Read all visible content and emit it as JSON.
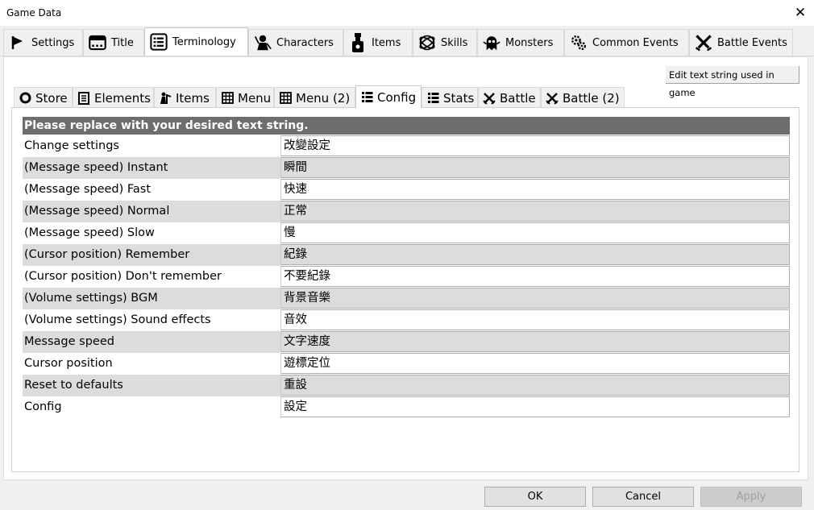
{
  "window": {
    "title": "Game Data",
    "close_glyph": "✕"
  },
  "main_tabs": [
    {
      "label": "Settings",
      "icon": "flag-icon"
    },
    {
      "label": "Title",
      "icon": "window-icon"
    },
    {
      "label": "Terminology",
      "icon": "list-icon",
      "active": true
    },
    {
      "label": "Characters",
      "icon": "character-icon"
    },
    {
      "label": "Items",
      "icon": "potion-icon"
    },
    {
      "label": "Skills",
      "icon": "orbit-icon"
    },
    {
      "label": "Monsters",
      "icon": "ghost-icon"
    },
    {
      "label": "Common Events",
      "icon": "gears-icon"
    },
    {
      "label": "Battle Events",
      "icon": "crossed-swords-icon"
    }
  ],
  "hint": "Edit text string used in game",
  "sub_tabs": [
    {
      "label": "Store",
      "icon": "circle-icon"
    },
    {
      "label": "Elements",
      "icon": "document-icon"
    },
    {
      "label": "Items",
      "icon": "items-icon"
    },
    {
      "label": "Menu",
      "icon": "grid-icon"
    },
    {
      "label": "Menu (2)",
      "icon": "grid-icon"
    },
    {
      "label": "Config",
      "icon": "list-icon",
      "active": true
    },
    {
      "label": "Stats",
      "icon": "list-icon"
    },
    {
      "label": "Battle",
      "icon": "swords-icon"
    },
    {
      "label": "Battle (2)",
      "icon": "swords-icon"
    }
  ],
  "table": {
    "header": "Please replace with your desired text string.",
    "rows": [
      {
        "key": "Change settings",
        "value": "改變設定"
      },
      {
        "key": "(Message speed) Instant",
        "value": "瞬間"
      },
      {
        "key": "(Message speed) Fast",
        "value": "快速"
      },
      {
        "key": "(Message speed) Normal",
        "value": "正常"
      },
      {
        "key": "(Message speed) Slow",
        "value": "慢"
      },
      {
        "key": "(Cursor position) Remember",
        "value": "紀錄"
      },
      {
        "key": "(Cursor position) Don't remember",
        "value": "不要紀錄"
      },
      {
        "key": "(Volume settings) BGM",
        "value": "背景音樂"
      },
      {
        "key": "(Volume settings) Sound effects",
        "value": "音效"
      },
      {
        "key": "Message speed",
        "value": "文字速度"
      },
      {
        "key": "Cursor position",
        "value": "遊標定位"
      },
      {
        "key": "Reset to defaults",
        "value": "重設"
      },
      {
        "key": "Config",
        "value": "設定"
      }
    ]
  },
  "buttons": {
    "ok": "OK",
    "cancel": "Cancel",
    "apply": "Apply"
  }
}
